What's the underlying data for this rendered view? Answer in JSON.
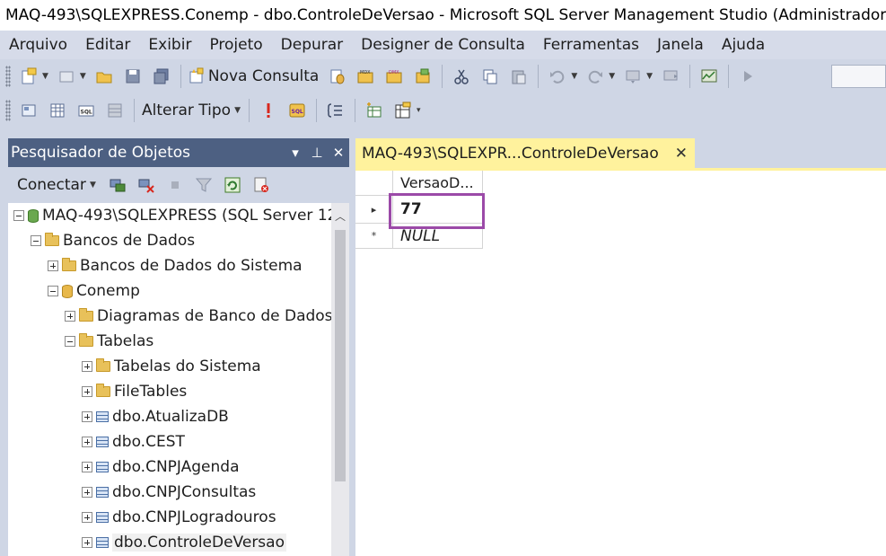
{
  "window": {
    "title": "MAQ-493\\SQLEXPRESS.Conemp - dbo.ControleDeVersao - Microsoft SQL Server Management Studio (Administrador)"
  },
  "menu": [
    "Arquivo",
    "Editar",
    "Exibir",
    "Projeto",
    "Depurar",
    "Designer de Consulta",
    "Ferramentas",
    "Janela",
    "Ajuda"
  ],
  "toolbar1": {
    "new_query_label": "Nova Consulta"
  },
  "toolbar2": {
    "change_type_label": "Alterar Tipo"
  },
  "object_explorer": {
    "title": "Pesquisador de Objetos",
    "connect_label": "Conectar",
    "tree": [
      {
        "label": "MAQ-493\\SQLEXPRESS (SQL Server 12",
        "icon": "server-icon",
        "expander": "minus"
      },
      {
        "label": "Bancos de Dados",
        "icon": "folder-icon",
        "expander": "minus"
      },
      {
        "label": "Bancos de Dados do Sistema",
        "icon": "folder-icon",
        "expander": "plus"
      },
      {
        "label": "Conemp",
        "icon": "database-icon",
        "expander": "minus"
      },
      {
        "label": "Diagramas de Banco de Dados",
        "icon": "folder-icon",
        "expander": "plus"
      },
      {
        "label": "Tabelas",
        "icon": "folder-icon",
        "expander": "minus"
      },
      {
        "label": "Tabelas do Sistema",
        "icon": "folder-icon",
        "expander": "plus"
      },
      {
        "label": "FileTables",
        "icon": "folder-icon",
        "expander": "plus"
      },
      {
        "label": "dbo.AtualizaDB",
        "icon": "table-icon",
        "expander": "plus"
      },
      {
        "label": "dbo.CEST",
        "icon": "table-icon",
        "expander": "plus"
      },
      {
        "label": "dbo.CNPJAgenda",
        "icon": "table-icon",
        "expander": "plus"
      },
      {
        "label": "dbo.CNPJConsultas",
        "icon": "table-icon",
        "expander": "plus"
      },
      {
        "label": "dbo.CNPJLogradouros",
        "icon": "table-icon",
        "expander": "plus"
      },
      {
        "label": "dbo.ControleDeVersao",
        "icon": "table-icon",
        "expander": "plus"
      }
    ]
  },
  "document": {
    "tab_label": "MAQ-493\\SQLEXPR...ControleDeVersao",
    "tab_close": "✕",
    "grid": {
      "column_header": "VersaoD...",
      "rows": [
        {
          "marker": "▸",
          "value": "77"
        },
        {
          "marker": "*",
          "value": "NULL"
        }
      ]
    }
  },
  "colors": {
    "highlight_border": "#9b4aa8",
    "active_tab": "#fff29d",
    "panel_header": "#4d6082"
  }
}
